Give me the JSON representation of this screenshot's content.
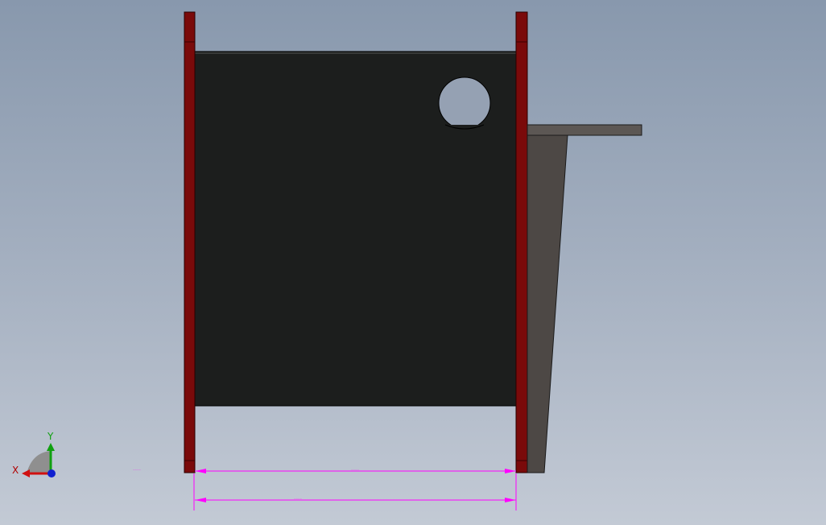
{
  "app": {
    "view": "front"
  },
  "colors": {
    "background_top": "#8898ad",
    "background_bottom": "#c3cad5",
    "flange": "#7a0a0a",
    "flange_edge": "#3a0000",
    "body": "#1c1e1d",
    "bracket": "#4d4845",
    "bracket_plate": "#5c5754",
    "dimension": "#ff00ff",
    "axis_x": "#d01010",
    "axis_y": "#10a010",
    "axis_z": "#1020d0",
    "axis_text": "#b00000"
  },
  "triad": {
    "x_label": "X",
    "y_label": "Y",
    "icon": "coordinate-triad-icon"
  },
  "dimensions": [
    {
      "id": "dim-inner",
      "text": "~~~~"
    },
    {
      "id": "dim-outer",
      "text": "~~~~"
    }
  ],
  "annotations": {
    "stray_text": "~~~~"
  }
}
